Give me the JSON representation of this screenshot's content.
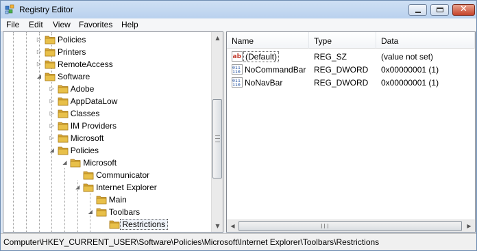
{
  "window": {
    "title": "Registry Editor",
    "icon": "registry-editor-icon"
  },
  "menu": [
    "File",
    "Edit",
    "View",
    "Favorites",
    "Help"
  ],
  "tree": {
    "items": [
      {
        "label": "Policies",
        "expander": "collapsed"
      },
      {
        "label": "Printers",
        "expander": "collapsed"
      },
      {
        "label": "RemoteAccess",
        "expander": "collapsed"
      },
      {
        "label": "Software",
        "expander": "expanded"
      },
      {
        "label": "Adobe",
        "expander": "collapsed"
      },
      {
        "label": "AppDataLow",
        "expander": "collapsed"
      },
      {
        "label": "Classes",
        "expander": "collapsed"
      },
      {
        "label": "IM Providers",
        "expander": "collapsed"
      },
      {
        "label": "Microsoft",
        "expander": "collapsed"
      },
      {
        "label": "Policies",
        "expander": "expanded"
      },
      {
        "label": "Microsoft",
        "expander": "expanded"
      },
      {
        "label": "Communicator",
        "expander": "none"
      },
      {
        "label": "Internet Explorer",
        "expander": "expanded"
      },
      {
        "label": "Main",
        "expander": "none"
      },
      {
        "label": "Toolbars",
        "expander": "expanded"
      },
      {
        "label": "Restrictions",
        "expander": "none",
        "selected": true
      }
    ]
  },
  "list": {
    "columns": [
      "Name",
      "Type",
      "Data"
    ],
    "rows": [
      {
        "name": "(Default)",
        "type": "REG_SZ",
        "data": "(value not set)",
        "icon": "string-value-icon"
      },
      {
        "name": "NoCommandBar",
        "type": "REG_DWORD",
        "data": "0x00000001 (1)",
        "icon": "binary-value-icon"
      },
      {
        "name": "NoNavBar",
        "type": "REG_DWORD",
        "data": "0x00000001 (1)",
        "icon": "binary-value-icon"
      }
    ]
  },
  "status": {
    "path": "Computer\\HKEY_CURRENT_USER\\Software\\Policies\\Microsoft\\Internet Explorer\\Toolbars\\Restrictions"
  },
  "colors": {
    "folder": "#e8c04a",
    "selection_bg": "#f0f4fa",
    "close_button": "#c5432b"
  }
}
